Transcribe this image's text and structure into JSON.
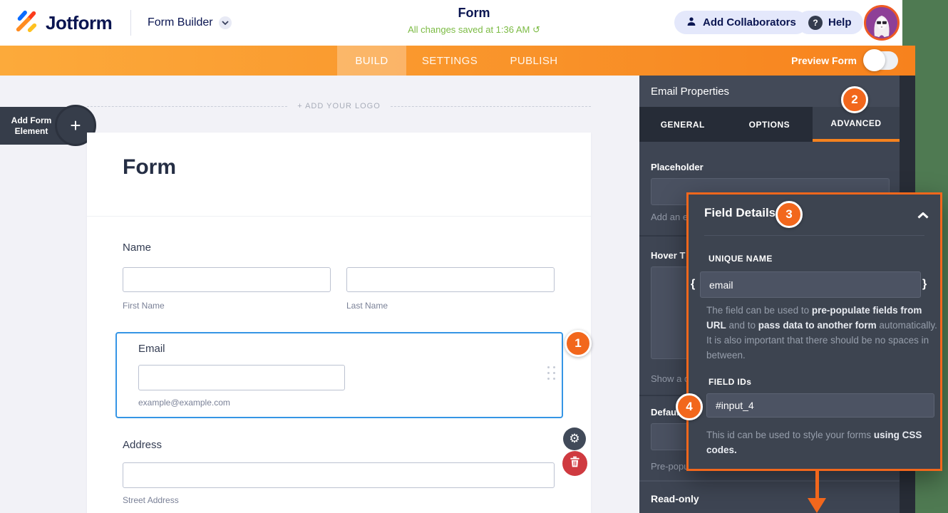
{
  "colors": {
    "accent_orange": "#f2671c",
    "navbar_orange_left": "#fcaa3b",
    "navbar_orange_right": "#f7821d",
    "brand_navy": "#0a1551",
    "saved_green": "#7cbb44",
    "selection_blue": "#3595e5",
    "danger_red": "#cf3a40",
    "panel_slate": "#3e4553",
    "desktop_green": "#4f7a52"
  },
  "header": {
    "brand": "Jotform",
    "app_switcher": "Form Builder",
    "form_title": "Form",
    "save_status": "All changes saved at 1:36 AM",
    "undo_icon": "↺",
    "add_collaborators_label": "Add Collaborators",
    "help_label": "Help",
    "help_icon": "?"
  },
  "navbar": {
    "tabs": [
      {
        "label": "BUILD"
      },
      {
        "label": "SETTINGS"
      },
      {
        "label": "PUBLISH"
      }
    ],
    "preview_label": "Preview Form"
  },
  "canvas": {
    "add_logo_label": "+ ADD YOUR LOGO",
    "add_element_label": "Add Form Element",
    "add_element_plus": "+",
    "form_heading": "Form",
    "name_field": {
      "label": "Name",
      "sublabel_first": "First Name",
      "sublabel_last": "Last Name"
    },
    "email_field": {
      "label": "Email",
      "sublabel": "example@example.com"
    },
    "address_field": {
      "label": "Address",
      "sublabel": "Street Address"
    }
  },
  "panel": {
    "title": "Email Properties",
    "tabs": [
      {
        "label": "GENERAL"
      },
      {
        "label": "OPTIONS"
      },
      {
        "label": "ADVANCED"
      }
    ],
    "placeholder_label": "Placeholder",
    "placeholder_help": "Add an e",
    "hover_label": "Hover T",
    "hover_help": "Show a d",
    "default_label": "Default",
    "default_help": "Pre-popu",
    "readonly_label": "Read-only"
  },
  "popup": {
    "title": "Field Details",
    "unique_name_label": "UNIQUE NAME",
    "brace_open": "{",
    "brace_close": "}",
    "unique_name_value": "email",
    "unique_desc": {
      "p1": "The field can be used to ",
      "p2": "pre-populate fields from URL",
      "p3": " and to ",
      "p4": "pass data to another form",
      "p5": " automatically. It is also important that there should be no spaces in between."
    },
    "field_ids_label": "FIELD IDs",
    "field_ids_value": "#input_4",
    "ids_desc": {
      "p1": "This id can be used to style your forms ",
      "p2": "using CSS codes."
    }
  },
  "annotations": {
    "step1": "1",
    "step2": "2",
    "step3": "3",
    "step4": "4"
  }
}
